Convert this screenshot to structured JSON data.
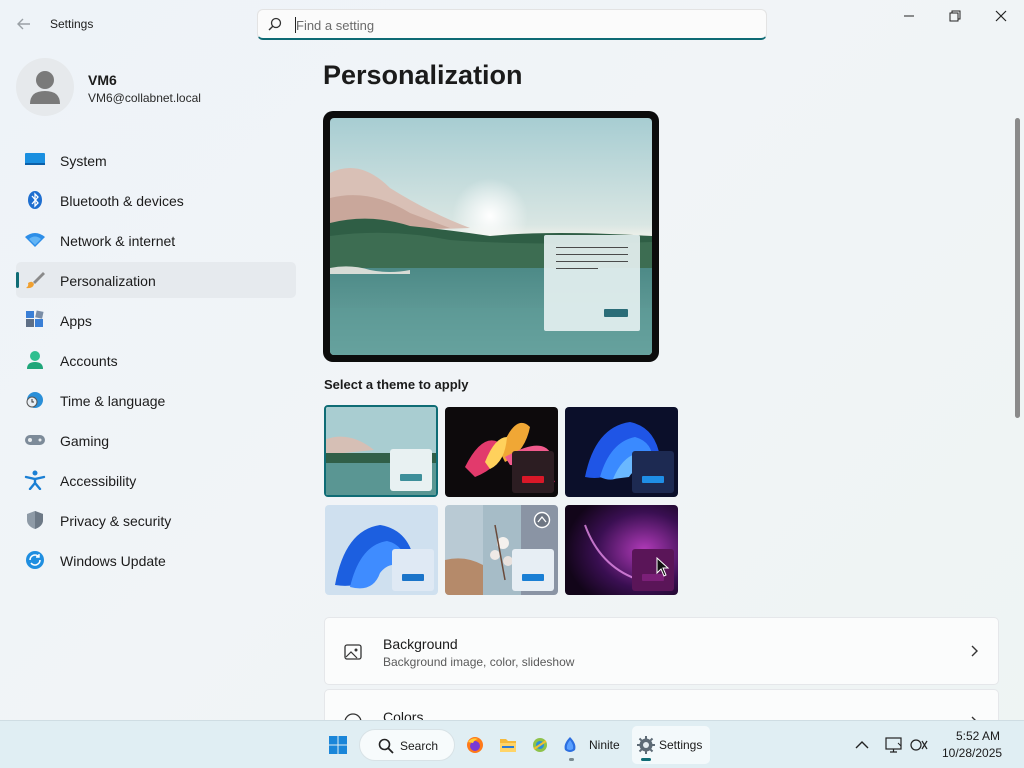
{
  "window": {
    "title": "Settings"
  },
  "search": {
    "placeholder": "Find a setting",
    "value": ""
  },
  "profile": {
    "name": "VM6",
    "email": "VM6@collabnet.local"
  },
  "sidebar": {
    "items": [
      {
        "label": "System",
        "icon": "system-icon"
      },
      {
        "label": "Bluetooth & devices",
        "icon": "bluetooth-icon"
      },
      {
        "label": "Network & internet",
        "icon": "wifi-icon"
      },
      {
        "label": "Personalization",
        "icon": "brush-icon",
        "active": true
      },
      {
        "label": "Apps",
        "icon": "apps-icon"
      },
      {
        "label": "Accounts",
        "icon": "accounts-icon"
      },
      {
        "label": "Time & language",
        "icon": "clock-globe-icon"
      },
      {
        "label": "Gaming",
        "icon": "gamepad-icon"
      },
      {
        "label": "Accessibility",
        "icon": "accessibility-icon"
      },
      {
        "label": "Privacy & security",
        "icon": "shield-icon"
      },
      {
        "label": "Windows Update",
        "icon": "update-icon"
      }
    ]
  },
  "main": {
    "title": "Personalization",
    "theme_heading": "Select a theme to apply",
    "themes": [
      {
        "name": "theme-lake",
        "selected": true,
        "chip_color": "#e8f1f2",
        "bar_color": "#3d8f9a"
      },
      {
        "name": "theme-flower",
        "chip_color": "#2c1d22",
        "bar_color": "#d91828"
      },
      {
        "name": "theme-dark-bloom",
        "chip_color": "#1d2a52",
        "bar_color": "#1f8ee6"
      },
      {
        "name": "theme-light-bloom",
        "chip_color": "#dfe9f4",
        "bar_color": "#1a74c9"
      },
      {
        "name": "theme-spotlight",
        "chip_color": "#e7eef4",
        "bar_color": "#1a7fd4"
      },
      {
        "name": "theme-glow",
        "chip_color": "#5a1558",
        "bar_color": "#7b1f78"
      }
    ],
    "cards": [
      {
        "title": "Background",
        "subtitle": "Background image, color, slideshow",
        "icon": "image-icon"
      },
      {
        "title": "Colors",
        "subtitle": "",
        "icon": "palette-icon"
      }
    ]
  },
  "taskbar": {
    "search_label": "Search",
    "ninite_label": "Ninite",
    "settings_label": "Settings",
    "time": "5:52 AM",
    "date": "10/28/2025"
  },
  "colors": {
    "accent": "#0f6c75"
  }
}
